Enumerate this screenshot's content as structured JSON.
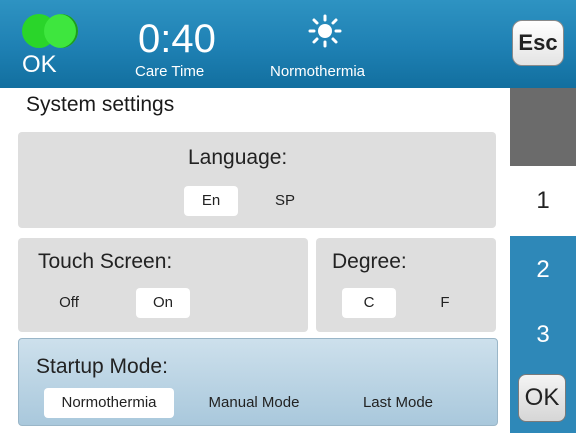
{
  "header": {
    "status_label": "OK",
    "time_value": "0:40",
    "time_label": "Care Time",
    "mode_label": "Normothermia",
    "esc_label": "Esc",
    "status_color": "#2ad52a"
  },
  "page_title": "System settings",
  "language": {
    "label": "Language:",
    "options": [
      "En",
      "SP"
    ],
    "selected": "En"
  },
  "touch_screen": {
    "label": "Touch Screen:",
    "options": [
      "Off",
      "On"
    ],
    "selected": "On"
  },
  "degree": {
    "label": "Degree:",
    "options": [
      "C",
      "F"
    ],
    "selected": "C"
  },
  "startup_mode": {
    "label": "Startup Mode:",
    "options": [
      "Normothermia",
      "Manual Mode",
      "Last Mode"
    ],
    "selected": "Normothermia"
  },
  "tabs": [
    "1",
    "2",
    "3"
  ],
  "active_tab": "1",
  "ok_button": "OK",
  "colors": {
    "header": "#1e80b3",
    "tab_blue": "#2e88b8",
    "panel_gray": "#dedede"
  }
}
